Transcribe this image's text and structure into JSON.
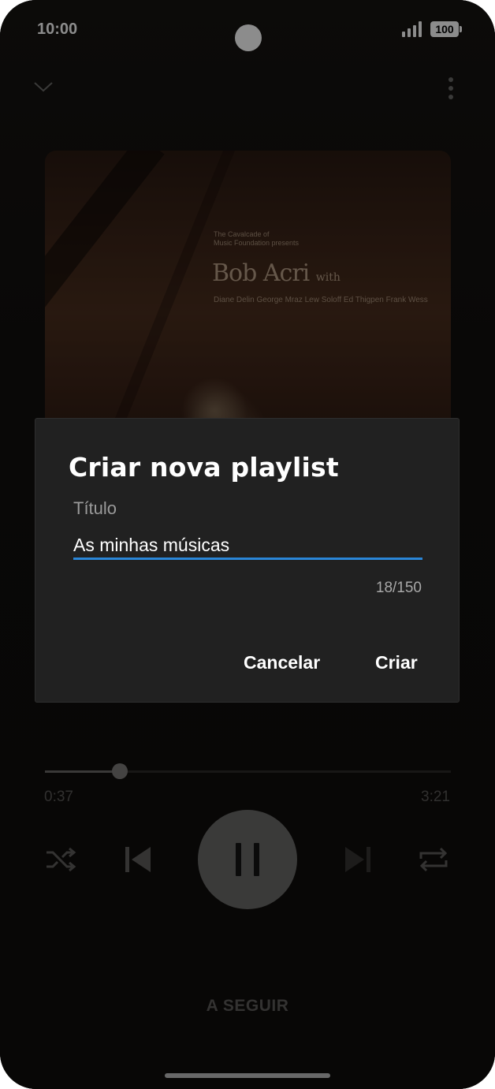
{
  "status_bar": {
    "time": "10:00",
    "battery": "100"
  },
  "album_art": {
    "presenter": "The Cavalcade of\nMusic Foundation presents",
    "title": "Bob Acri",
    "title_suffix": "with",
    "musicians": "Diane Delin George Mraz Lew Soloff  Ed Thigpen Frank Wess"
  },
  "dialog": {
    "title": "Criar nova playlist",
    "field_label": "Título",
    "field_value": "As minhas músicas",
    "counter": "18/150",
    "cancel_label": "Cancelar",
    "create_label": "Criar",
    "accent_color": "#2a86d8"
  },
  "player": {
    "elapsed": "0:37",
    "duration": "3:21",
    "progress_fraction": 0.184
  },
  "up_next_label": "A SEGUIR",
  "icons": [
    "chevron-down-icon",
    "more-vert-icon",
    "shuffle-icon",
    "skip-previous-icon",
    "pause-icon",
    "skip-next-icon",
    "repeat-icon",
    "signal-icon",
    "battery-icon"
  ]
}
